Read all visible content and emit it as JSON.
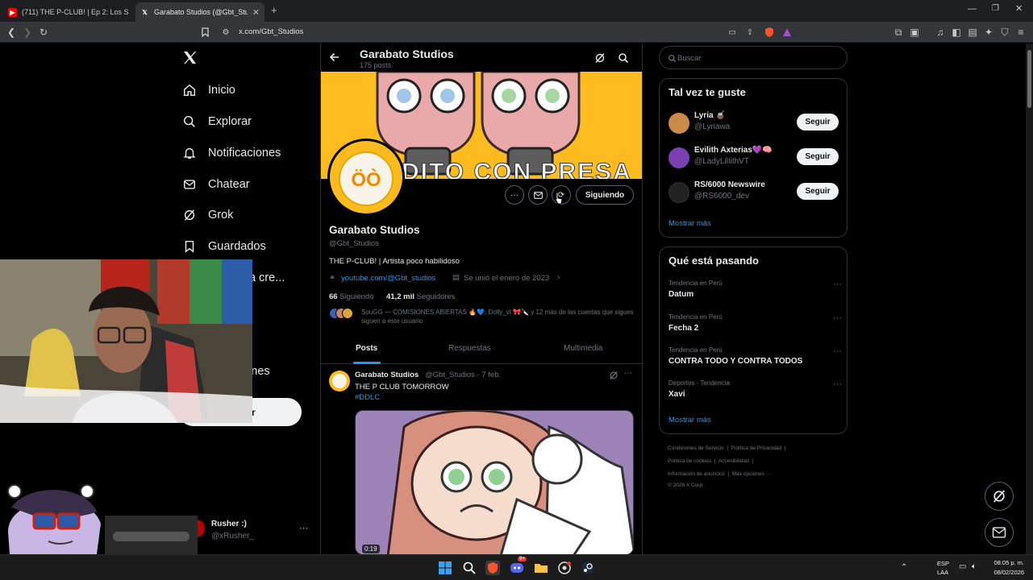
{
  "browser": {
    "tabs": [
      {
        "label": "(711) THE P-CLUB! | Ep 2: Los Suplem",
        "active": false
      },
      {
        "label": "Garabato Studios (@Gbt_Studio",
        "active": true
      }
    ],
    "new_tab": "+",
    "url": "x.com/Gbt_Studios"
  },
  "sidebar": {
    "logo": "X",
    "items": [
      {
        "label": "Inicio",
        "icon": "home-icon"
      },
      {
        "label": "Explorar",
        "icon": "search-icon"
      },
      {
        "label": "Notificaciones",
        "icon": "bell-icon"
      },
      {
        "label": "Chatear",
        "icon": "mail-icon"
      },
      {
        "label": "Grok",
        "icon": "grok-icon"
      },
      {
        "label": "Guardados",
        "icon": "bookmark-icon"
      },
      {
        "label": "para cre...",
        "icon": ""
      },
      {
        "label": "iones",
        "icon": ""
      }
    ],
    "post_button_fragment": "r",
    "account": {
      "name": "Rusher :)",
      "handle": "@xRusher_",
      "more": "···"
    }
  },
  "profile_header": {
    "name": "Garabato Studios",
    "posts_count": "175 posts"
  },
  "banner": {
    "text": "DITO CON PRESA",
    "bg_color": "#fdbb1f"
  },
  "profile": {
    "name": "Garabato Studios",
    "handle": "@Gbt_Studios",
    "bio": "THE P-CLUB! | Artista poco habilidoso",
    "link": "youtube.com/@Gbt_studios",
    "joined": "Se unió el enero de 2023",
    "following_count": "66",
    "following_label": "Siguiendo",
    "followers_count": "41,2 mil",
    "followers_label": "Seguidores",
    "followed_by": "SouGG — COMISIONES ABIERTAS 🔥💙, Dolly_vt 🎀🔪 y 12 más de las cuentas que sigues siguen a este usuario",
    "follow_button": "Siguiendo"
  },
  "tabs": [
    {
      "label": "Posts",
      "active": true
    },
    {
      "label": "Respuestas",
      "active": false
    },
    {
      "label": "Multimedia",
      "active": false
    }
  ],
  "post": {
    "author": "Garabato Studios",
    "handle_time": "@Gbt_Studios · 7 feb.",
    "text": "THE P CLUB TOMORROW",
    "hashtag": "#DDLC",
    "video_time": "0:19",
    "more": "···"
  },
  "search": {
    "placeholder": "Buscar"
  },
  "suggestions": {
    "title": "Tal vez te guste",
    "items": [
      {
        "name": "Lyria 🧉",
        "handle": "@Lyriawa",
        "button": "Seguir",
        "avatar_color": "#c98a4a"
      },
      {
        "name": "Evilith Axterias💜🧠",
        "handle": "@LadyLilIithVT",
        "button": "Seguir",
        "avatar_color": "#7a3fb0"
      },
      {
        "name": "RS/6000 Newswire",
        "handle": "@RS6000_dev",
        "button": "Seguir",
        "avatar_color": "#222222"
      }
    ],
    "show_more": "Mostrar más"
  },
  "trends": {
    "title": "Qué está pasando",
    "items": [
      {
        "context": "Tendencia en Perú",
        "name": "Datum"
      },
      {
        "context": "Tendencia en Perú",
        "name": "Fecha 2"
      },
      {
        "context": "Tendencia en Perú",
        "name": "CONTRA TODO Y CONTRA TODOS"
      },
      {
        "context": "Deportes · Tendencia",
        "name": "Xavi"
      }
    ],
    "more_icon": "···",
    "show_more": "Mostrar más"
  },
  "footer": {
    "row1": [
      "Condiciones de Servicio",
      "Política de Privacidad"
    ],
    "row2": [
      "Política de cookies",
      "Accesibilidad"
    ],
    "row3": [
      "Información de anuncios",
      "Más opciones ···"
    ],
    "copyright": "© 2026 X Corp."
  },
  "taskbar": {
    "lang": "ESP",
    "lang2": "LAA",
    "time": "08:05 p. m.",
    "date": "08/02/2026",
    "discord_badge": "9+"
  },
  "colors": {
    "accent": "#1d9bf0",
    "banner": "#fdbb1f"
  }
}
